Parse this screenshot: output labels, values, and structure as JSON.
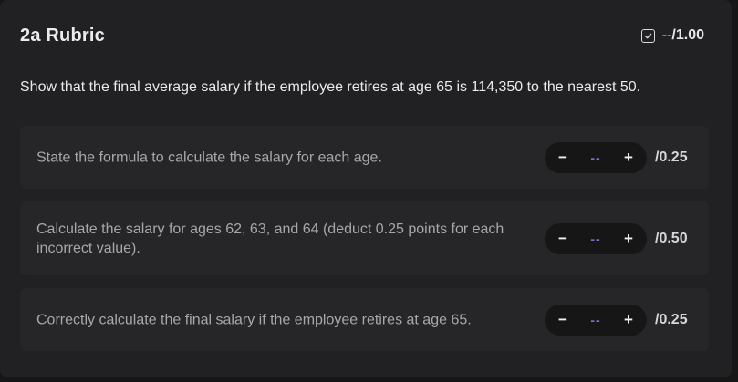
{
  "header": {
    "title": "2a Rubric",
    "score_value": "--",
    "score_total": "/1.00",
    "check_icon": "checkbox-icon"
  },
  "question": "Show that the final average salary if the employee retires at age 65 is 114,350 to the nearest 50.",
  "criteria": [
    {
      "text": "State the formula to calculate the salary for each age.",
      "minus": "−",
      "value": "--",
      "plus": "+",
      "max": "/0.25"
    },
    {
      "text": "Calculate the salary for ages 62, 63, and 64 (deduct 0.25 points for each incorrect value).",
      "minus": "−",
      "value": "--",
      "plus": "+",
      "max": "/0.50"
    },
    {
      "text": "Correctly calculate the final salary if the employee retires at age 65.",
      "minus": "−",
      "value": "--",
      "plus": "+",
      "max": "/0.25"
    }
  ],
  "colors": {
    "accent": "#7e71c6",
    "panel": "#212123",
    "row": "#262628"
  }
}
